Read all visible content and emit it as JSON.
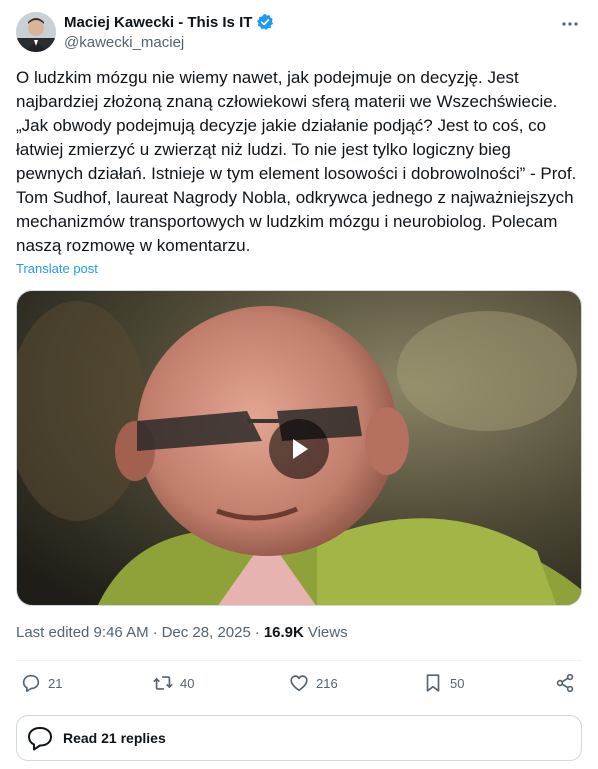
{
  "author": {
    "display_name": "Maciej Kawecki - This Is IT",
    "handle": "@kawecki_maciej",
    "verified": true,
    "avatar_icon": "avatar-photo"
  },
  "post": {
    "text": "O ludzkim mózgu nie wiemy nawet, jak podejmuje on decyzję. Jest najbardziej złożoną znaną człowiekowi sferą materii we Wszechświecie. „Jak obwody podejmują decyzje jakie działanie podjąć? Jest to coś, co łatwiej zmierzyć u zwierząt niż ludzi. To nie jest tylko logiczny bieg pewnych działań. Istnieje w tym element losowości i dobrowolności” - Prof. Tom Sudhof, laureat Nagrody Nobla, odkrywca jednego z najważniejszych mechanizmów transportowych w ludzkim mózgu i neurobiolog. Polecam naszą rozmowę w komentarzu.",
    "translate_label": "Translate post",
    "media_icon": "play-icon"
  },
  "meta": {
    "edited": "Last edited 9:46 AM",
    "dot1": "·",
    "date": "Dec 28, 2025",
    "dot2": "·",
    "views_count": "16.9K",
    "views_label": "Views"
  },
  "actions": {
    "replies": "21",
    "reposts": "40",
    "likes": "216",
    "bookmarks": "50"
  },
  "read_replies_label": "Read 21 replies",
  "colors": {
    "accent": "#1d9bf0",
    "text": "#0f1419",
    "secondary": "#536471",
    "border": "#cfd9de"
  }
}
